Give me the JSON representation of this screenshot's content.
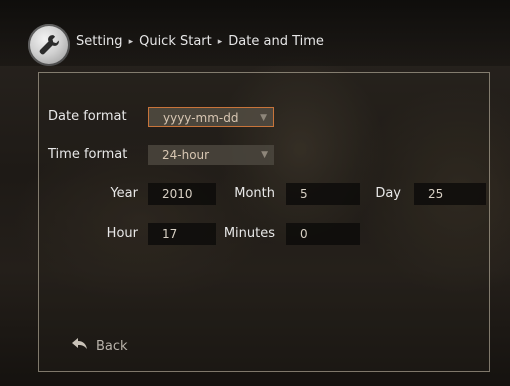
{
  "breadcrumb": {
    "items": [
      "Setting",
      "Quick Start",
      "Date and Time"
    ],
    "separator": "▸"
  },
  "icons": {
    "header": "wrench-icon",
    "back": "back-arrow-icon",
    "dropdown": "dropdown-arrow-icon"
  },
  "form": {
    "date_format": {
      "label": "Date format",
      "value": "yyyy-mm-dd"
    },
    "time_format": {
      "label": "Time format",
      "value": "24-hour"
    },
    "year": {
      "label": "Year",
      "value": "2010"
    },
    "month": {
      "label": "Month",
      "value": "5"
    },
    "day": {
      "label": "Day",
      "value": "25"
    },
    "hour": {
      "label": "Hour",
      "value": "17"
    },
    "minutes": {
      "label": "Minutes",
      "value": "0"
    }
  },
  "back_label": "Back",
  "colors": {
    "focus_border": "#c8743a",
    "field_bg": "#0c0b0a",
    "select_bg": "#4b463e"
  }
}
